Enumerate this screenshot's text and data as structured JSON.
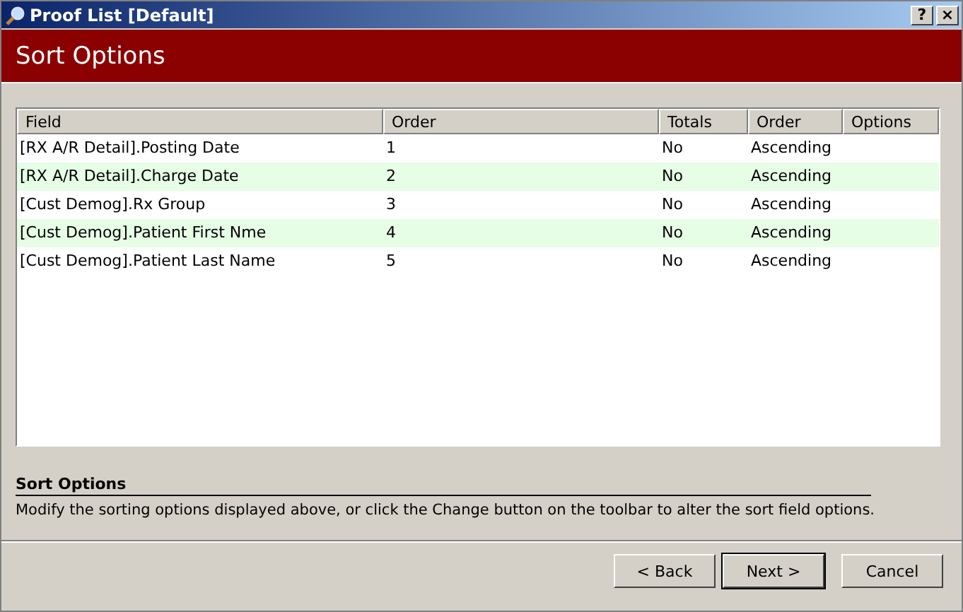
{
  "window": {
    "title": "Proof List [Default]",
    "controls": [
      "?",
      "×"
    ]
  },
  "header": {
    "title": "Sort Options"
  },
  "table": {
    "columns": [
      "Field",
      "Order",
      "Totals",
      "Order",
      "Options"
    ],
    "rows": [
      {
        "field": "[RX A/R Detail].Posting Date",
        "order": "1",
        "totals": "No",
        "direction": "Ascending"
      },
      {
        "field": "[RX A/R Detail].Charge Date",
        "order": "2",
        "totals": "No",
        "direction": "Ascending"
      },
      {
        "field": "[Cust Demog].Rx Group",
        "order": "3",
        "totals": "No",
        "direction": "Ascending"
      },
      {
        "field": "[Cust Demog].Patient First Nme",
        "order": "4",
        "totals": "No",
        "direction": "Ascending"
      },
      {
        "field": "[Cust Demog].Patient Last Name",
        "order": "5",
        "totals": "No",
        "direction": "Ascending"
      }
    ]
  },
  "description": {
    "title": "Sort Options",
    "text": "Modify the sorting options displayed above, or click the Change button on the toolbar to alter the sort field options."
  },
  "buttons": [
    {
      "label": "< Back",
      "default": false
    },
    {
      "label": "Next >",
      "default": true
    },
    {
      "label": "Cancel",
      "default": false
    }
  ]
}
